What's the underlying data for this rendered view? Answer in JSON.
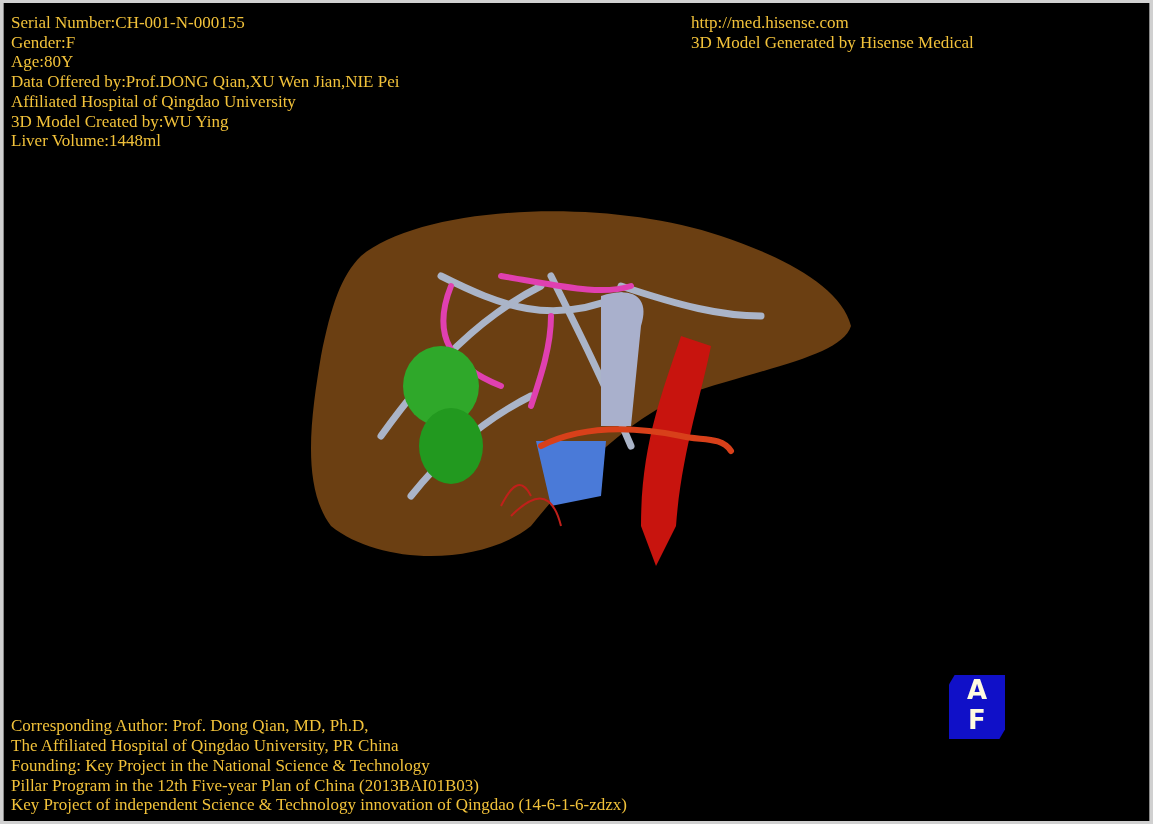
{
  "info_left": [
    "Serial Number:CH-001-N-000155",
    "Gender:F",
    "Age:80Y",
    "Data Offered by:Prof.DONG Qian,XU Wen Jian,NIE Pei",
    "Affiliated Hospital of Qingdao University",
    "3D Model Created by:WU Ying",
    "Liver Volume:1448ml"
  ],
  "info_right": [
    "http://med.hisense.com",
    "3D Model Generated by Hisense Medical"
  ],
  "footer": [
    "Corresponding Author: Prof. Dong Qian, MD, Ph.D,",
    "The Affiliated Hospital of Qingdao University, PR China",
    "Founding: Key Project in the National Science & Technology",
    "Pillar Program in the 12th Five-year Plan of China (2013BAI01B03)",
    "Key Project of independent Science & Technology innovation of Qingdao (14-6-1-6-zdzx)"
  ],
  "orientation_cube": {
    "top": "A",
    "front": "F"
  }
}
